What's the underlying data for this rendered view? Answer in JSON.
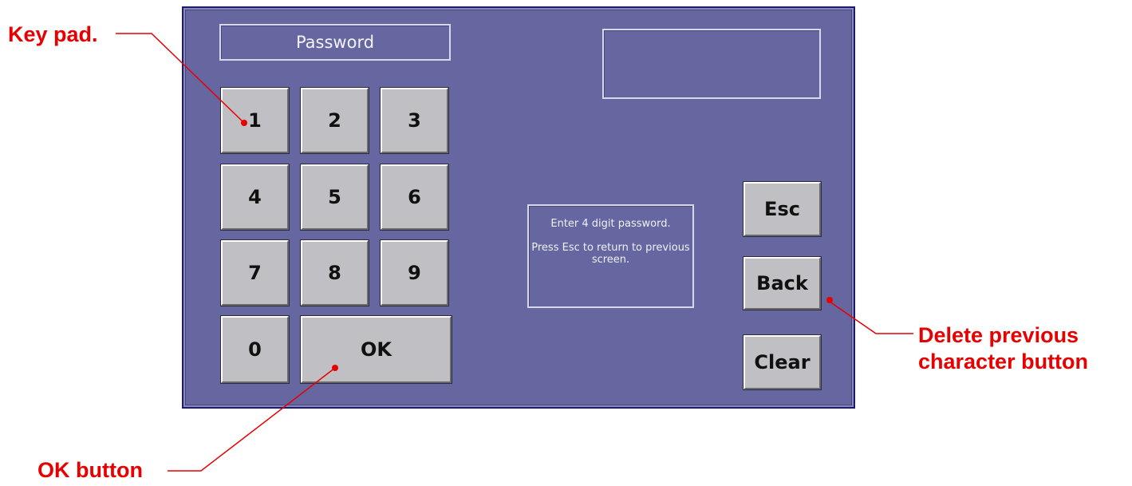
{
  "screen": {
    "title": "Password",
    "display_value": "",
    "instructions_line1": "Enter 4 digit password.",
    "instructions_line2": "Press Esc to return to previous screen."
  },
  "keypad": {
    "keys": [
      "1",
      "2",
      "3",
      "4",
      "5",
      "6",
      "7",
      "8",
      "9",
      "0"
    ],
    "ok_label": "OK"
  },
  "side_buttons": {
    "esc_label": "Esc",
    "back_label": "Back",
    "clear_label": "Clear"
  },
  "annotations": {
    "keypad_label": "Key pad.",
    "ok_label": "OK button",
    "delete_label_line1": "Delete previous",
    "delete_label_line2": "character button"
  },
  "colors": {
    "panel": "#6666a0",
    "key": "#c0c0c4",
    "annotation": "#e60000"
  }
}
